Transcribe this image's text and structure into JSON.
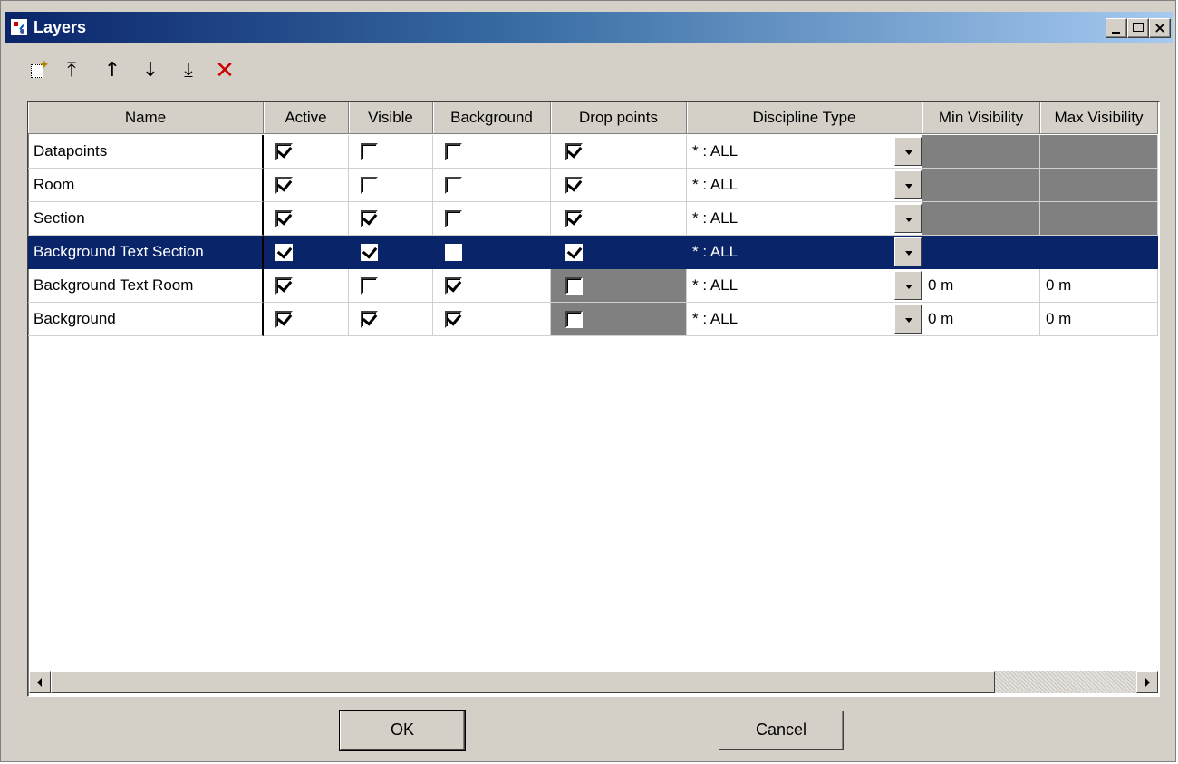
{
  "window": {
    "title": "Layers"
  },
  "title_buttons": {
    "minimize": "_",
    "maximize": "□",
    "close": "×"
  },
  "toolbar": [
    {
      "name": "new-layer-button",
      "icon": "new-layer-icon",
      "glyph": ""
    },
    {
      "name": "move-top-button",
      "icon": "move-to-top-icon",
      "glyph": "⤒"
    },
    {
      "name": "move-up-button",
      "icon": "arrow-up-icon",
      "glyph": "↑"
    },
    {
      "name": "move-down-button",
      "icon": "arrow-down-icon",
      "glyph": "↓"
    },
    {
      "name": "move-bottom-button",
      "icon": "move-to-bottom-icon",
      "glyph": "⤓"
    },
    {
      "name": "delete-button",
      "icon": "delete-x-icon",
      "glyph": "✕"
    }
  ],
  "columns": [
    "Name",
    "Active",
    "Visible",
    "Background",
    "Drop points",
    "Discipline Type",
    "Min Visibility",
    "Max Visibility"
  ],
  "rows": [
    {
      "name": "Datapoints",
      "active": true,
      "visible": false,
      "background": false,
      "drop_points": true,
      "drop_points_enabled": true,
      "discipline": "* : ALL",
      "min_visibility": "",
      "max_visibility": "",
      "visibility_enabled": false,
      "selected": false
    },
    {
      "name": "Room",
      "active": true,
      "visible": false,
      "background": false,
      "drop_points": true,
      "drop_points_enabled": true,
      "discipline": "* : ALL",
      "min_visibility": "",
      "max_visibility": "",
      "visibility_enabled": false,
      "selected": false
    },
    {
      "name": "Section",
      "active": true,
      "visible": true,
      "background": false,
      "drop_points": true,
      "drop_points_enabled": true,
      "discipline": "* : ALL",
      "min_visibility": "",
      "max_visibility": "",
      "visibility_enabled": false,
      "selected": false
    },
    {
      "name": "Background Text Section",
      "active": true,
      "visible": true,
      "background": false,
      "drop_points": true,
      "drop_points_enabled": true,
      "discipline": "* : ALL",
      "min_visibility": "",
      "max_visibility": "",
      "visibility_enabled": false,
      "selected": true
    },
    {
      "name": "Background Text Room",
      "active": true,
      "visible": false,
      "background": true,
      "drop_points": false,
      "drop_points_enabled": false,
      "discipline": "* : ALL",
      "min_visibility": "0 m",
      "max_visibility": "0 m",
      "visibility_enabled": true,
      "selected": false
    },
    {
      "name": "Background",
      "active": true,
      "visible": true,
      "background": true,
      "drop_points": false,
      "drop_points_enabled": false,
      "discipline": "* : ALL",
      "min_visibility": "0 m",
      "max_visibility": "0 m",
      "visibility_enabled": true,
      "selected": false
    }
  ],
  "buttons": {
    "ok": "OK",
    "cancel": "Cancel"
  },
  "colors": {
    "selection": "#0a246a",
    "disabled_cell": "#808080",
    "face": "#d4d0c8",
    "delete": "#cc0000"
  }
}
